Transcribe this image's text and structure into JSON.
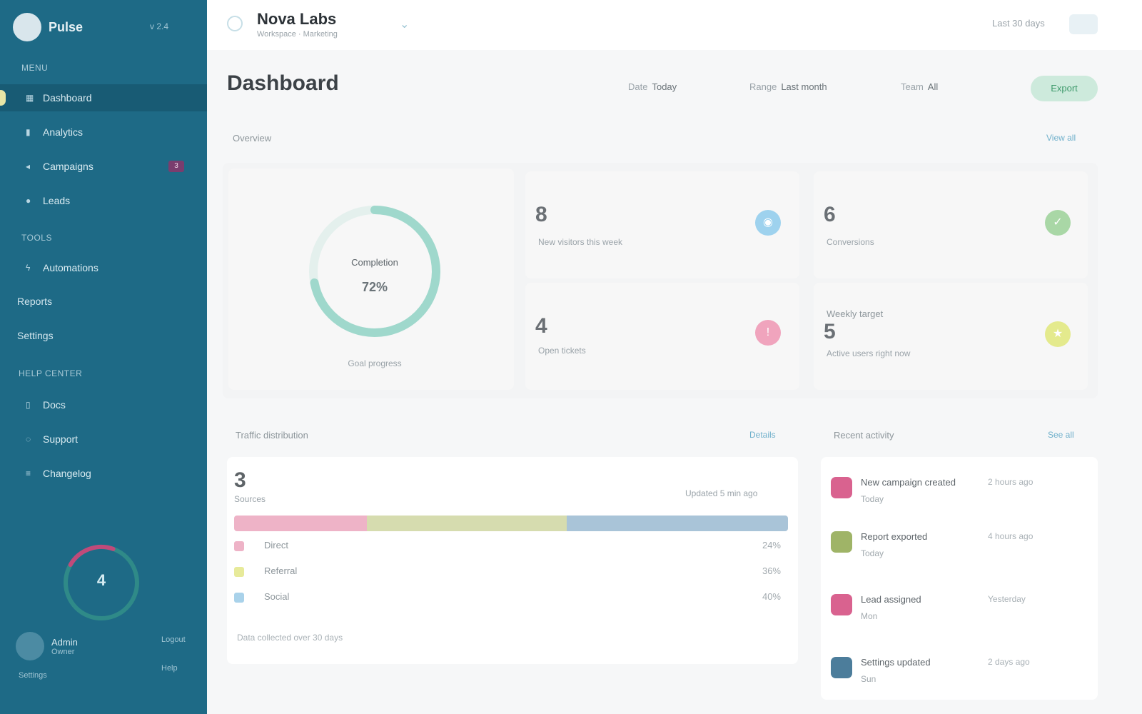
{
  "app": {
    "logo": "Pulse",
    "version": "v 2.4"
  },
  "sidebar": {
    "section_main": "Menu",
    "items": [
      {
        "label": "Dashboard",
        "icon": "grid-icon"
      },
      {
        "label": "Analytics",
        "icon": "chart-icon"
      },
      {
        "label": "Campaigns",
        "icon": "megaphone-icon",
        "badge": "3"
      },
      {
        "label": "Leads",
        "icon": "user-icon"
      }
    ],
    "section_tools": "Tools",
    "tool_items": [
      {
        "label": "Automations",
        "icon": "bolt-icon"
      }
    ],
    "plain_items": [
      "Reports",
      "Settings"
    ],
    "section_support": "Help Center",
    "support_items": [
      {
        "label": "Docs",
        "icon": "book-icon"
      },
      {
        "label": "Support",
        "icon": "chat-icon"
      },
      {
        "label": "Changelog",
        "icon": "list-icon"
      }
    ],
    "gauge": {
      "value": "4",
      "progress": 0.22
    },
    "user": {
      "name": "Admin",
      "role": "Owner"
    },
    "footer_a": "Logout",
    "footer_b": "Help",
    "footer_c": "Settings"
  },
  "topbar": {
    "name": "Nova Labs",
    "subtitle": "Workspace · Marketing",
    "right_text": "Last 30 days"
  },
  "header": {
    "title": "Dashboard",
    "filters": [
      {
        "label": "Date",
        "value": "Today"
      },
      {
        "label": "Range",
        "value": "Last month"
      },
      {
        "label": "Team",
        "value": "All"
      }
    ],
    "action": "Export"
  },
  "overview": {
    "label": "Overview",
    "link": "View all",
    "donut": {
      "label": "Completion",
      "value": "72%",
      "caption": "Goal progress",
      "progress": 0.72,
      "color": "#9fd8cc"
    },
    "stats": [
      {
        "value": "8",
        "label": "New visitors this week",
        "icon": "eye-icon",
        "icon_color": "#9ed2ee"
      },
      {
        "value": "6",
        "label": "Conversions",
        "icon": "check-icon",
        "icon_color": "#a9d7a6"
      },
      {
        "value": "4",
        "label": "Open tickets",
        "icon": "alert-icon",
        "icon_color": "#f0a4bd"
      },
      {
        "value": "5",
        "label": "Active users right now",
        "extra": "Weekly target",
        "icon": "star-icon",
        "icon_color": "#e4ea8d"
      }
    ]
  },
  "distribution": {
    "label": "Traffic distribution",
    "link": "Details",
    "value": "3",
    "value_label": "Sources",
    "right_text": "Updated 5 min ago",
    "segments": [
      {
        "name": "Direct",
        "value": "24%",
        "share": 0.24,
        "color": "#eeb3c7"
      },
      {
        "name": "Referral",
        "value": "36%",
        "share": 0.36,
        "color": "#d6dcaf"
      },
      {
        "name": "Social",
        "value": "40%",
        "share": 0.4,
        "color": "#a9c4d8"
      }
    ],
    "footer": "Data collected over 30 days"
  },
  "activity": {
    "label": "Recent activity",
    "link": "See all",
    "items": [
      {
        "title": "New campaign created",
        "meta": "2 hours ago",
        "time": "Today",
        "color": "#d9628f"
      },
      {
        "title": "Report exported",
        "meta": "4 hours ago",
        "time": "Today",
        "color": "#9fb467"
      },
      {
        "title": "Lead assigned",
        "meta": "Yesterday",
        "time": "Mon",
        "color": "#d9628f"
      },
      {
        "title": "Settings updated",
        "meta": "2 days ago",
        "time": "Sun",
        "color": "#4c7d9b"
      }
    ]
  }
}
